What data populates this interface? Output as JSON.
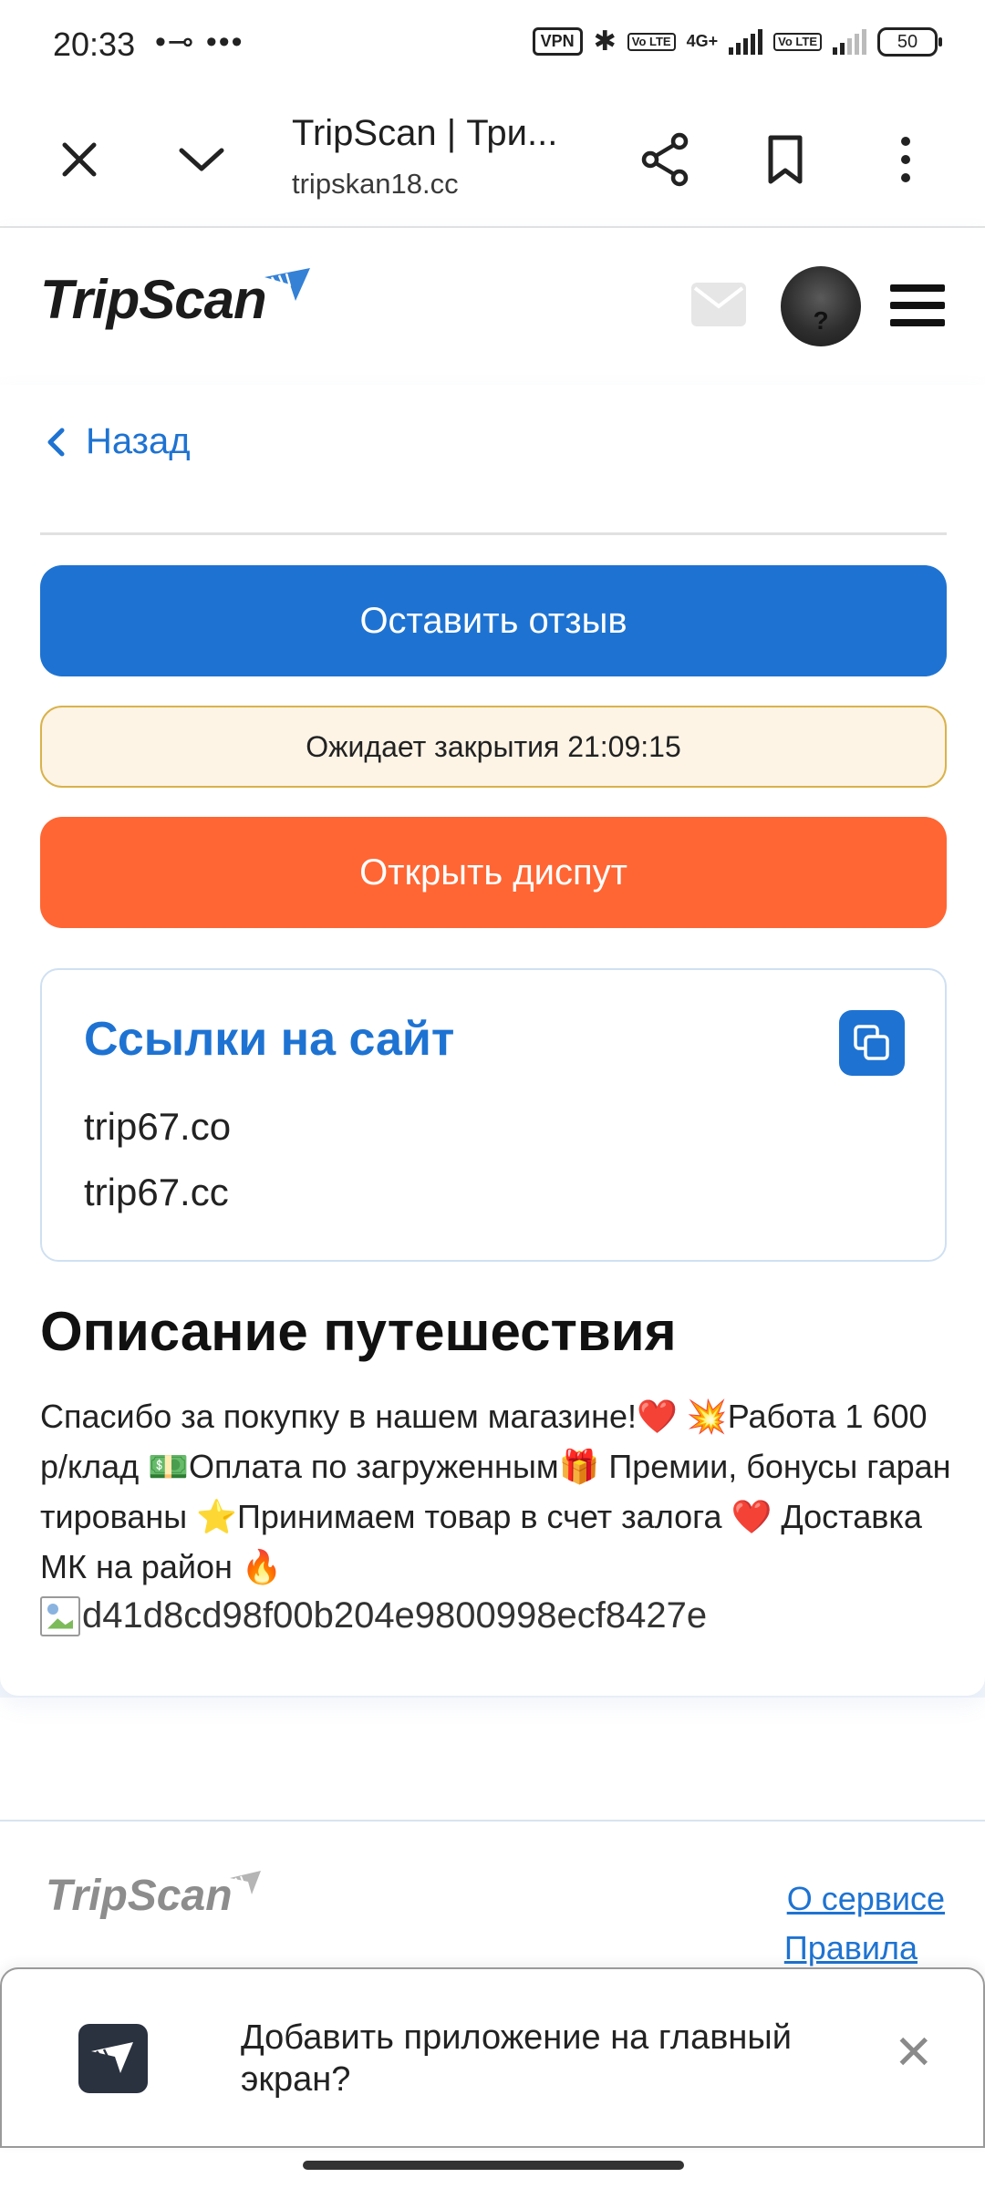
{
  "status_bar": {
    "time": "20:33",
    "extra": "•⊸ •••",
    "vpn": "VPN",
    "lte1": "Vo LTE",
    "network": "4G+",
    "lte2": "Vo LTE",
    "battery": "50"
  },
  "browser": {
    "title": "TripScan | Три...",
    "url": "tripskan18.cc"
  },
  "site": {
    "logo": "TripScan",
    "avatar_symbol": "?"
  },
  "page": {
    "back_label": "Назад",
    "review_button": "Оставить отзыв",
    "timer_text": "Ожидает закрытия 21:09:15",
    "dispute_button": "Открыть диспут",
    "links_title": "Ссылки на сайт",
    "links": [
      "trip67.co",
      "trip67.cc"
    ],
    "description_title": "Описание путешествия",
    "description_text": "Спасибо за покупку в нашем магазине!❤️ 💥Работа 1 600р/клад 💵Оплата по загруженным🎁 Премии, бонусы гарантированы ⭐Принимаем товар в счет залога ❤️ Доставка МК на район 🔥",
    "broken_image_alt": "d41d8cd98f00b204e9800998ecf8427e"
  },
  "footer": {
    "logo": "TripScan",
    "about_link": "О сервисе",
    "rules_link": "Правила"
  },
  "install_banner": {
    "text": "Добавить приложение на главный экран?",
    "close_symbol": "✕"
  },
  "colors": {
    "accent_blue": "#1e73d2",
    "dispute_orange": "#ff6633",
    "timer_bg": "#fdf4e6",
    "timer_border": "#d9b24a"
  }
}
